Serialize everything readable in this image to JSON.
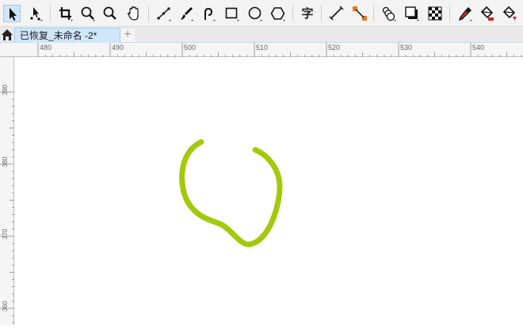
{
  "toolbar": {
    "tools": [
      {
        "name": "pick-tool-icon"
      },
      {
        "name": "shape-tool-icon"
      },
      {
        "name": "crop-tool-icon"
      },
      {
        "name": "zoom-tool-icon"
      },
      {
        "name": "magnify-icon"
      },
      {
        "name": "pan-hand-icon"
      },
      {
        "name": "freehand-line-icon"
      },
      {
        "name": "artistic-brush-icon"
      },
      {
        "name": "smart-draw-icon"
      },
      {
        "name": "rectangle-tool-icon"
      },
      {
        "name": "ellipse-tool-icon"
      },
      {
        "name": "polygon-tool-icon"
      },
      {
        "name": "text-tool-icon"
      },
      {
        "name": "parallel-dimension-icon"
      },
      {
        "name": "connector-tool-icon"
      },
      {
        "name": "blend-tool-icon"
      },
      {
        "name": "drop-shadow-icon"
      },
      {
        "name": "transparency-icon"
      },
      {
        "name": "eyedropper-icon"
      },
      {
        "name": "interactive-fill-icon"
      },
      {
        "name": "smart-fill-icon"
      }
    ],
    "text_tool_glyph": "字"
  },
  "tabs": {
    "home_icon": "home-icon",
    "document_tab": "已恢复_未命名 -2*",
    "add_tab": "+"
  },
  "rulers": {
    "horizontal_labels": [
      "480",
      "490",
      "500",
      "510",
      "520",
      "530",
      "540"
    ],
    "vertical_labels": [
      "390",
      "380",
      "370",
      "360"
    ]
  },
  "drawing": {
    "stroke_color": "#a3c90b"
  }
}
